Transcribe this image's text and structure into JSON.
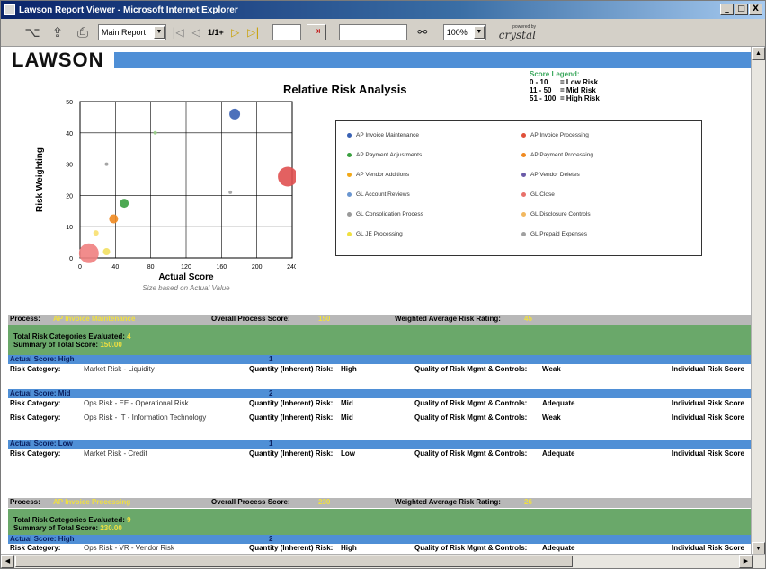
{
  "window": {
    "title": "Lawson Report Viewer - Microsoft Internet Explorer",
    "controls": [
      "_",
      "□",
      "X"
    ]
  },
  "toolbar": {
    "report_select": "Main Report",
    "page": "1/1+",
    "zoom": "100%",
    "brand_small": "powered by",
    "brand": "crystal"
  },
  "report": {
    "logo": "LAWSON",
    "title": "Relative Risk Analysis",
    "score_legend": {
      "title": "Score Legend:",
      "rows": [
        {
          "range": "0 - 10",
          "label": "= Low Risk"
        },
        {
          "range": "11 - 50",
          "label": "= Mid Risk"
        },
        {
          "range": "51 - 100",
          "label": "= High Risk"
        }
      ]
    },
    "series_legend": [
      {
        "label": "AP Invoice Maintenance",
        "color": "#3a62b4"
      },
      {
        "label": "AP Invoice Processing",
        "color": "#e0503a"
      },
      {
        "label": "AP Payment Adjustments",
        "color": "#3aa040"
      },
      {
        "label": "AP Payment Processing",
        "color": "#f08a20"
      },
      {
        "label": "AP Vendor Additions",
        "color": "#f2a818"
      },
      {
        "label": "AP Vendor Deletes",
        "color": "#6a5aa8"
      },
      {
        "label": "GL Account Reviews",
        "color": "#6a96d0"
      },
      {
        "label": "GL Close",
        "color": "#e8706a"
      },
      {
        "label": "GL Consolidation Process",
        "color": "#9a9a9a"
      },
      {
        "label": "GL Disclosure Controls",
        "color": "#f2b860"
      },
      {
        "label": "GL JE Processing",
        "color": "#f0e040"
      },
      {
        "label": "GL Prepaid Expenses",
        "color": "#a0a0a0"
      }
    ],
    "sections": [
      {
        "process_label": "Process:",
        "process_value": "AP Invoice Maintenance",
        "overall_label": "Overall Process Score:",
        "overall_value": "150",
        "weighted_label": "Weighted Average Risk Rating:",
        "weighted_value": "45",
        "total_label": "Total Risk Categories Evaluated:",
        "total_value": "4",
        "summary_label": "Summary of Total Score:",
        "summary_value": "150.00"
      },
      {
        "process_label": "Process:",
        "process_value": "AP Invoice Processing",
        "overall_label": "Overall Process Score:",
        "overall_value": "230",
        "weighted_label": "Weighted Average Risk Rating:",
        "weighted_value": "26",
        "total_label": "Total Risk Categories Evaluated:",
        "total_value": "9",
        "summary_label": "Summary of Total Score:",
        "summary_value": "230.00"
      }
    ],
    "groups": [
      {
        "header": "Actual Score: High",
        "count": "1"
      },
      {
        "header": "Actual Score: Mid",
        "count": "2"
      },
      {
        "header": "Actual Score: Low",
        "count": "1"
      },
      {
        "header": "Actual Score: High",
        "count": "2"
      }
    ],
    "rows": [
      {
        "cat_label": "Risk Category:",
        "cat_value": "Market Risk - Liquidity",
        "qty_label": "Quantity (Inherent) Risk:",
        "qty_value": "High",
        "qual_label": "Quality of Risk Mgmt & Controls:",
        "qual_value": "Weak",
        "ind_label": "Individual Risk Score"
      },
      {
        "cat_label": "Risk Category:",
        "cat_value": "Ops Risk - EE - Operational Risk",
        "qty_label": "Quantity (Inherent) Risk:",
        "qty_value": "Mid",
        "qual_label": "Quality of Risk Mgmt & Controls:",
        "qual_value": "Adequate",
        "ind_label": "Individual Risk Score"
      },
      {
        "cat_label": "Risk Category:",
        "cat_value": "Ops Risk - IT - Information Technology",
        "qty_label": "Quantity (Inherent) Risk:",
        "qty_value": "Mid",
        "qual_label": "Quality of Risk Mgmt & Controls:",
        "qual_value": "Weak",
        "ind_label": "Individual Risk Score"
      },
      {
        "cat_label": "Risk Category:",
        "cat_value": "Market Risk - Credit",
        "qty_label": "Quantity (Inherent) Risk:",
        "qty_value": "Low",
        "qual_label": "Quality of Risk Mgmt & Controls:",
        "qual_value": "Adequate",
        "ind_label": "Individual Risk Score"
      },
      {
        "cat_label": "Risk Category:",
        "cat_value": "Ops Risk - VR - Vendor Risk",
        "qty_label": "Quantity (Inherent) Risk:",
        "qty_value": "High",
        "qual_label": "Quality of Risk Mgmt & Controls:",
        "qual_value": "Adequate",
        "ind_label": "Individual Risk Score"
      }
    ]
  },
  "chart_data": {
    "type": "scatter",
    "title": "",
    "xlabel": "Actual Score",
    "subtitle": "Size based on Actual Value",
    "ylabel": "Risk Weighting",
    "xlim": [
      0,
      240
    ],
    "ylim": [
      0,
      50
    ],
    "xticks": [
      "0",
      "40",
      "80",
      "120",
      "160",
      "200",
      "240"
    ],
    "yticks": [
      "0",
      "10",
      "20",
      "30",
      "40",
      "50"
    ],
    "points": [
      {
        "x": 175,
        "y": 46,
        "size": 6,
        "color": "#3a62b4"
      },
      {
        "x": 235,
        "y": 26,
        "size": 11,
        "color": "#e05050"
      },
      {
        "x": 50,
        "y": 17.5,
        "size": 5,
        "color": "#3aa040"
      },
      {
        "x": 38,
        "y": 12.5,
        "size": 5,
        "color": "#f08a20"
      },
      {
        "x": 85,
        "y": 40,
        "size": 2,
        "color": "#9ad08a"
      },
      {
        "x": 30,
        "y": 30,
        "size": 2,
        "color": "#9a9a9a"
      },
      {
        "x": 170,
        "y": 21,
        "size": 2,
        "color": "#a0a0a0"
      },
      {
        "x": 18,
        "y": 8,
        "size": 3,
        "color": "#f8e070"
      },
      {
        "x": 30,
        "y": 2,
        "size": 4,
        "color": "#f2e060"
      },
      {
        "x": 10,
        "y": 1.5,
        "size": 11,
        "color": "#f08080"
      }
    ]
  }
}
